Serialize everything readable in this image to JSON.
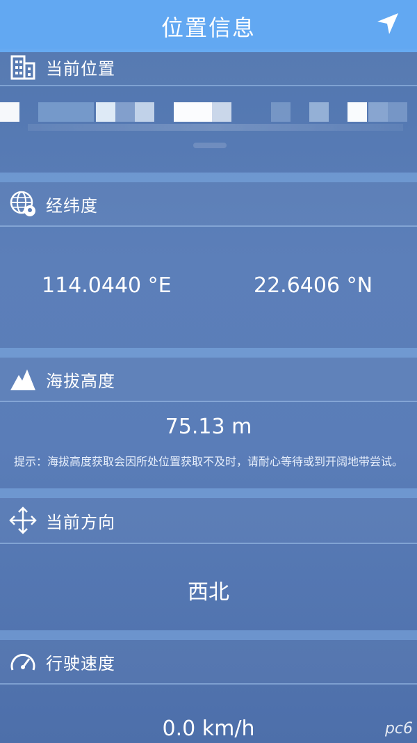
{
  "header": {
    "title": "位置信息",
    "nav_icon": "navigation-arrow-icon"
  },
  "location": {
    "label": "当前位置",
    "icon": "building-icon"
  },
  "coordinates": {
    "label": "经纬度",
    "icon": "globe-pin-icon",
    "longitude": "114.0440 °E",
    "latitude": "22.6406 °N"
  },
  "altitude": {
    "label": "海拔高度",
    "icon": "mountain-icon",
    "value": "75.13 m",
    "hint": "提示：海拔高度获取会因所处位置获取不及时，请耐心等待或到开阔地带尝试。"
  },
  "direction": {
    "label": "当前方向",
    "icon": "move-arrows-icon",
    "value": "西北"
  },
  "speed": {
    "label": "行驶速度",
    "icon": "speedometer-icon",
    "value": "0.0 km/h"
  },
  "watermark": "pc6"
}
